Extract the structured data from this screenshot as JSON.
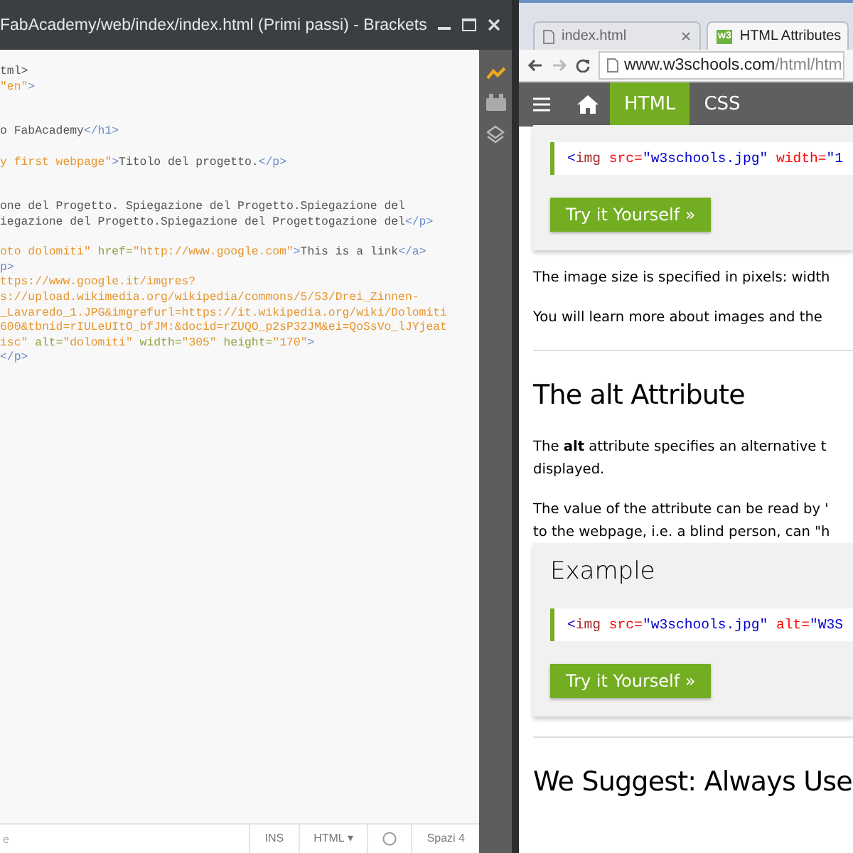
{
  "editor": {
    "title": "FabAcademy/web/index/index.html (Primi passi) - Brackets",
    "lines": [
      [
        {
          "kind": "text",
          "text": "tml>"
        }
      ],
      [
        {
          "kind": "string",
          "text": "\"en\""
        },
        {
          "kind": "tag",
          "text": ">"
        }
      ],
      [
        {
          "kind": "blank"
        }
      ],
      [
        {
          "kind": "blank"
        }
      ],
      [
        {
          "kind": "text",
          "text": "o FabAcademy"
        },
        {
          "kind": "tag",
          "text": "</h1>"
        }
      ],
      [
        {
          "kind": "blank"
        }
      ],
      [
        {
          "kind": "string",
          "text": "y first webpage\""
        },
        {
          "kind": "tag",
          "text": ">"
        },
        {
          "kind": "text",
          "text": "Titolo del progetto."
        },
        {
          "kind": "tag",
          "text": "</p>"
        }
      ],
      [
        {
          "kind": "blank"
        }
      ],
      [
        {
          "kind": "blank"
        }
      ],
      [
        {
          "kind": "text",
          "text": "one del Progetto. Spiegazione del Progetto.Spiegazione del"
        }
      ],
      [
        {
          "kind": "text",
          "text": "iegazione del Progetto.Spiegazione del Progettogazione del"
        },
        {
          "kind": "tag",
          "text": "</p>"
        }
      ],
      [
        {
          "kind": "blank"
        }
      ],
      [
        {
          "kind": "string",
          "text": "oto dolomiti\""
        },
        {
          "kind": "attr",
          "text": " href="
        },
        {
          "kind": "string",
          "text": "\"http://www.google.com\""
        },
        {
          "kind": "tag",
          "text": ">"
        },
        {
          "kind": "text",
          "text": "This is a link"
        },
        {
          "kind": "tag",
          "text": "</a>"
        }
      ],
      [
        {
          "kind": "tag",
          "text": "p>"
        }
      ],
      [
        {
          "kind": "string",
          "text": "ttps://www.google.it/imgres?"
        }
      ],
      [
        {
          "kind": "string",
          "text": "s://upload.wikimedia.org/wikipedia/commons/5/53/Drei_Zinnen-"
        }
      ],
      [
        {
          "kind": "string",
          "text": "_Lavaredo_1.JPG&imgrefurl=https://it.wikipedia.org/wiki/Dolomiti"
        }
      ],
      [
        {
          "kind": "string",
          "text": "600&tbnid=rIULeUItO_bfJM:&docid=rZUQO_p2sP32JM&ei=QoSsVo_lJYjeat"
        }
      ],
      [
        {
          "kind": "string",
          "text": "isc\""
        },
        {
          "kind": "attr",
          "text": " alt="
        },
        {
          "kind": "string",
          "text": "\"dolomiti\""
        },
        {
          "kind": "attr",
          "text": " width="
        },
        {
          "kind": "string",
          "text": "\"305\""
        },
        {
          "kind": "attr",
          "text": " height="
        },
        {
          "kind": "string",
          "text": "\"170\""
        },
        {
          "kind": "tag",
          "text": ">"
        }
      ],
      [
        {
          "kind": "tag",
          "text": "</p>"
        }
      ]
    ],
    "status_bar": {
      "left": "e",
      "mode": "INS",
      "language": "HTML",
      "language_caret": "▾",
      "indent": "Spazi 4"
    }
  },
  "browser": {
    "tabs": [
      {
        "label": "index.html",
        "selected": false
      },
      {
        "label": "HTML Attributes",
        "selected": true
      }
    ],
    "favicon": "w3",
    "url_host": "www.w3schools.com",
    "url_path": "/html/htm",
    "nav": [
      {
        "label": "HTML",
        "selected": true
      },
      {
        "label": "CSS",
        "selected": false
      }
    ],
    "content": [
      {
        "kind": "example",
        "code": [
          {
            "kind": "bracket",
            "text": "<"
          },
          {
            "kind": "tagname",
            "text": "img"
          },
          {
            "kind": "attr",
            "text": " src="
          },
          {
            "kind": "value",
            "text": "\"w3schools.jpg\""
          },
          {
            "kind": "attr",
            "text": " width="
          },
          {
            "kind": "value",
            "text": "\"1"
          }
        ],
        "button": "Try it Yourself »"
      },
      {
        "kind": "paragraph",
        "lines": [
          "The image size is specified in pixels: width"
        ]
      },
      {
        "kind": "paragraph",
        "lines": [
          "You will learn more about images and the"
        ]
      },
      {
        "kind": "rule"
      },
      {
        "kind": "heading",
        "text": "The alt Attribute"
      },
      {
        "kind": "paragraph",
        "lines": [
          "The **alt** attribute specifies an alternative t",
          "displayed."
        ]
      },
      {
        "kind": "paragraph",
        "lines": [
          "The value of the attribute can be read by '",
          "to the webpage, i.e. a blind person, can \"h"
        ]
      },
      {
        "kind": "example",
        "title": "Example",
        "code": [
          {
            "kind": "bracket",
            "text": "<"
          },
          {
            "kind": "tagname",
            "text": "img"
          },
          {
            "kind": "attr",
            "text": " src="
          },
          {
            "kind": "value",
            "text": "\"w3schools.jpg\""
          },
          {
            "kind": "attr",
            "text": " alt="
          },
          {
            "kind": "value",
            "text": "\"W3S"
          }
        ],
        "button": "Try it Yourself »"
      },
      {
        "kind": "rule"
      },
      {
        "kind": "heading",
        "text": "We Suggest: Always Use"
      }
    ]
  }
}
